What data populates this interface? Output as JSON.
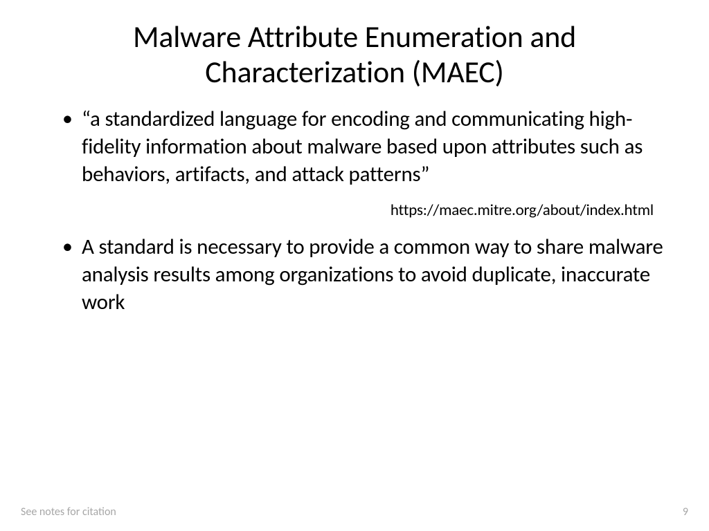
{
  "slide": {
    "title": "Malware Attribute Enumeration and Characterization (MAEC)",
    "bullets": [
      "“a standardized language for encoding and communicating high-fidelity information about malware based upon attributes such as behaviors, artifacts, and attack patterns”",
      "A standard is necessary to provide a common way to share malware analysis results among organizations to avoid duplicate, inaccurate work"
    ],
    "citation_url": "https://maec.mitre.org/about/index.html",
    "footer_note": "See notes for citation",
    "page_number": "9"
  }
}
